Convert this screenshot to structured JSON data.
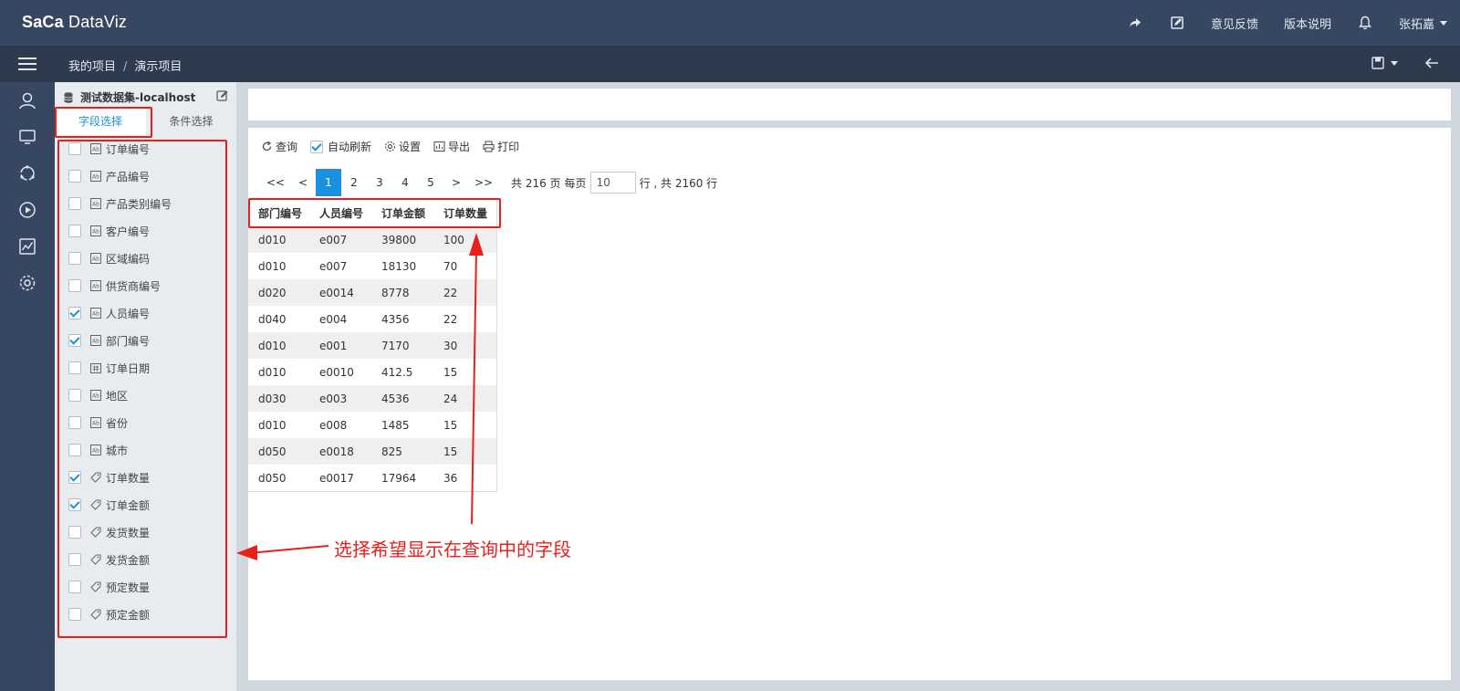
{
  "app": {
    "logo_brand": "SaCa",
    "logo_product": "DataViz"
  },
  "topnav": {
    "feedback": "意见反馈",
    "release_notes": "版本说明",
    "user": "张拓嘉"
  },
  "breadcrumb": {
    "root": "我的项目",
    "separator": "/",
    "current": "演示项目"
  },
  "iconbar": {
    "items": [
      "user-icon",
      "monitor-icon",
      "refresh-icon",
      "play-icon",
      "chart-icon",
      "settings-icon"
    ]
  },
  "dataset": {
    "name": "测试数据集-localhost"
  },
  "tabs": {
    "field_select": "字段选择",
    "condition_select": "条件选择"
  },
  "fields": [
    {
      "label": "订单编号",
      "type": "text",
      "checked": false
    },
    {
      "label": "产品编号",
      "type": "text",
      "checked": false
    },
    {
      "label": "产品类别编号",
      "type": "text",
      "checked": false
    },
    {
      "label": "客户编号",
      "type": "text",
      "checked": false
    },
    {
      "label": "区域编码",
      "type": "text",
      "checked": false
    },
    {
      "label": "供货商编号",
      "type": "text",
      "checked": false
    },
    {
      "label": "人员编号",
      "type": "text",
      "checked": true
    },
    {
      "label": "部门编号",
      "type": "text",
      "checked": true
    },
    {
      "label": "订单日期",
      "type": "date",
      "checked": false
    },
    {
      "label": "地区",
      "type": "text",
      "checked": false
    },
    {
      "label": "省份",
      "type": "text",
      "checked": false
    },
    {
      "label": "城市",
      "type": "text",
      "checked": false
    },
    {
      "label": "订单数量",
      "type": "measure",
      "checked": true
    },
    {
      "label": "订单金额",
      "type": "measure",
      "checked": true
    },
    {
      "label": "发货数量",
      "type": "measure",
      "checked": false
    },
    {
      "label": "发货金额",
      "type": "measure",
      "checked": false
    },
    {
      "label": "预定数量",
      "type": "measure",
      "checked": false
    },
    {
      "label": "预定金额",
      "type": "measure",
      "checked": false
    }
  ],
  "toolbar": {
    "query": "查询",
    "auto_refresh": "自动刷新",
    "settings": "设置",
    "export": "导出",
    "print": "打印"
  },
  "pager": {
    "first": "<<",
    "prev": "<",
    "pages": [
      "1",
      "2",
      "3",
      "4",
      "5"
    ],
    "current": "1",
    "next": ">",
    "last": ">>",
    "total_pages_text": "共 216 页",
    "per_page_label": "每页",
    "per_page_value": "10",
    "total_rows_text": "行 , 共 2160 行"
  },
  "table": {
    "columns": [
      "部门编号",
      "人员编号",
      "订单金额",
      "订单数量"
    ],
    "rows": [
      [
        "d010",
        "e007",
        "39800",
        "100"
      ],
      [
        "d010",
        "e007",
        "18130",
        "70"
      ],
      [
        "d020",
        "e0014",
        "8778",
        "22"
      ],
      [
        "d040",
        "e004",
        "4356",
        "22"
      ],
      [
        "d010",
        "e001",
        "7170",
        "30"
      ],
      [
        "d010",
        "e0010",
        "412.5",
        "15"
      ],
      [
        "d030",
        "e003",
        "4536",
        "24"
      ],
      [
        "d010",
        "e008",
        "1485",
        "15"
      ],
      [
        "d050",
        "e0018",
        "825",
        "15"
      ],
      [
        "d050",
        "e0017",
        "17964",
        "36"
      ]
    ]
  },
  "annotation": {
    "text": "选择希望显示在查询中的字段",
    "color": "#e8201c"
  }
}
